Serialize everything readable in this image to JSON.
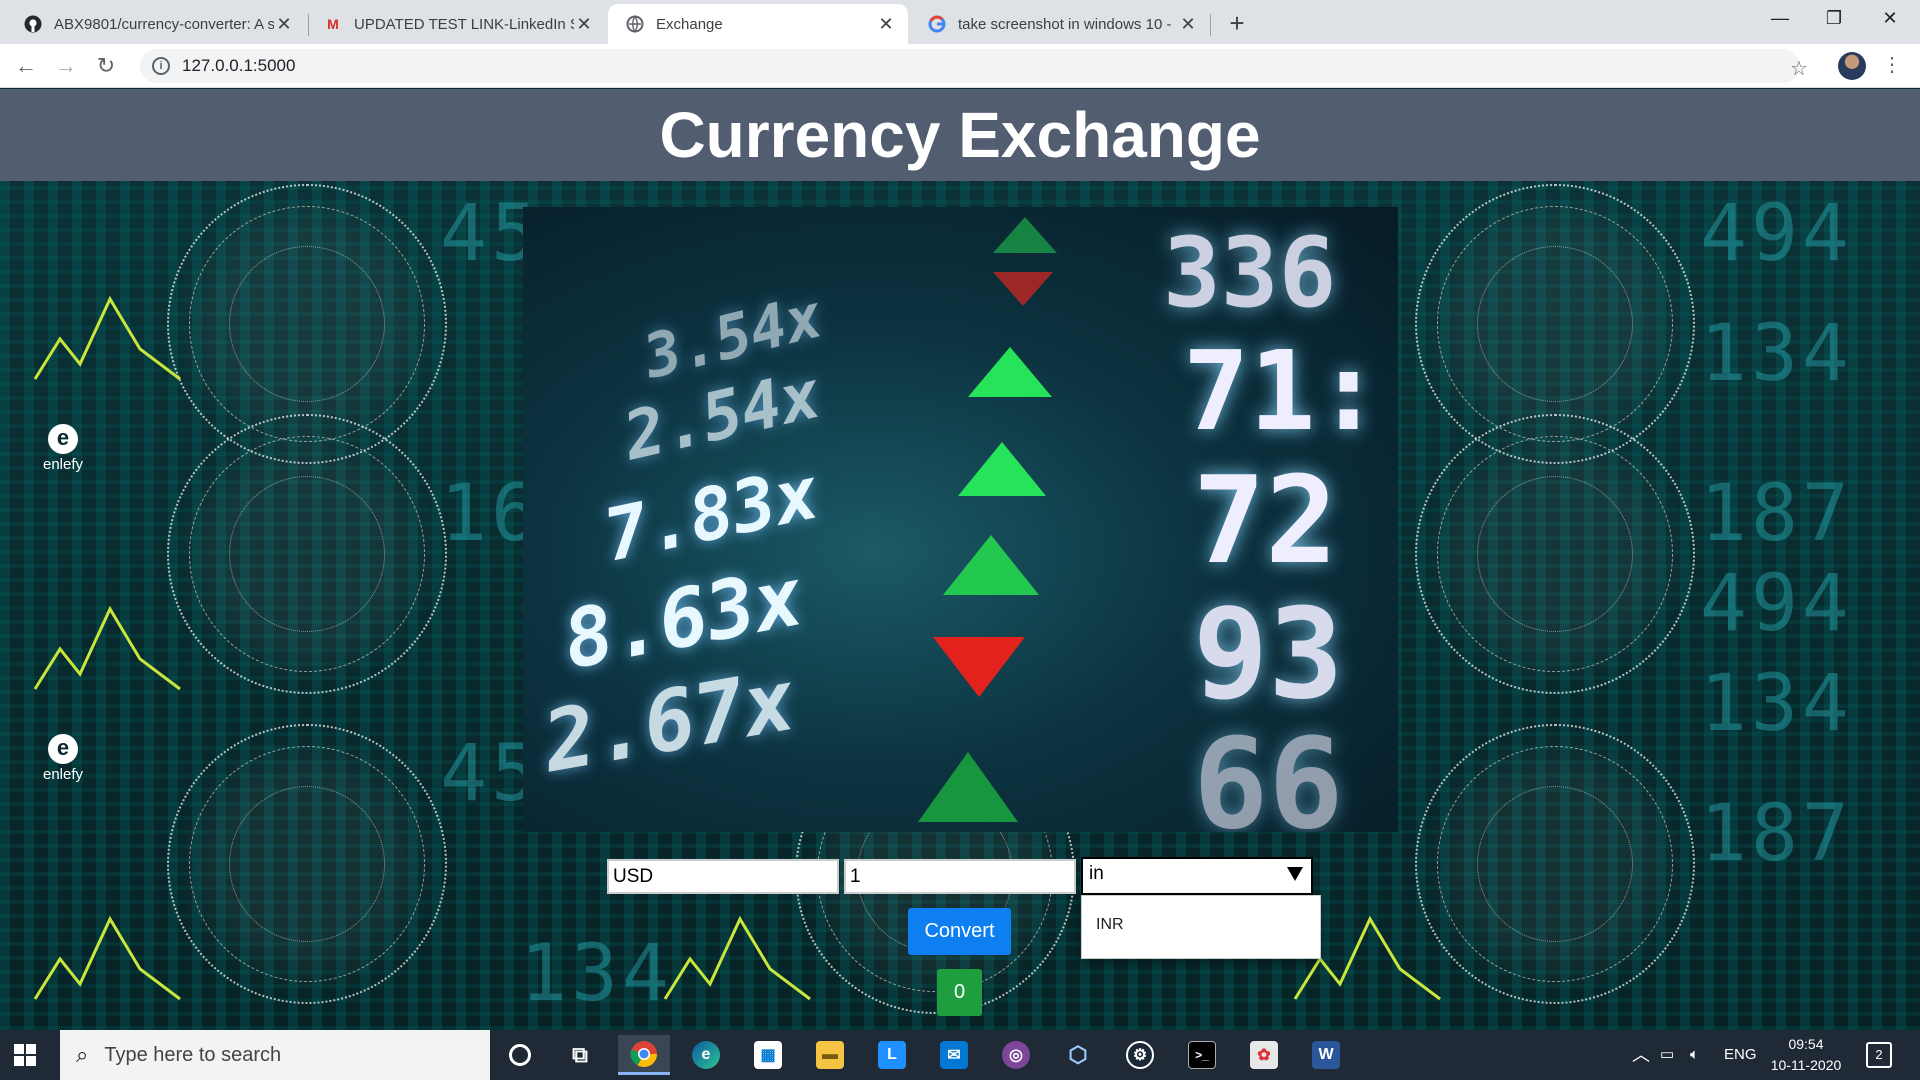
{
  "browser": {
    "tabs": [
      {
        "title": "ABX9801/currency-converter: A s",
        "icon": "github-icon"
      },
      {
        "title": "UPDATED TEST LINK-LinkedIn Su",
        "icon": "gmail-icon"
      },
      {
        "title": "Exchange",
        "icon": "globe-icon"
      },
      {
        "title": "take screenshot in windows 10 - ",
        "icon": "google-icon"
      }
    ],
    "url": "127.0.0.1:5000"
  },
  "page": {
    "title": "Currency Exchange",
    "hero_rows": [
      "3.54x",
      "2.54x",
      "7.83x",
      "8.63x",
      "2.67x"
    ],
    "hero_big": [
      "336",
      "71:",
      "72",
      "93",
      "66"
    ],
    "from_currency": "USD",
    "amount": "1",
    "select_value": "in",
    "dropdown_option": "INR",
    "convert_label": "Convert",
    "result": "0",
    "brand": "enlefy"
  },
  "taskbar": {
    "search_placeholder": "Type here to search",
    "language": "ENG",
    "time": "09:54",
    "date": "10-11-2020",
    "notifications": "2"
  },
  "colors": {
    "header_bg": "#555f73",
    "convert_button": "#0d7ff0",
    "result_badge": "#1e9e3e"
  }
}
